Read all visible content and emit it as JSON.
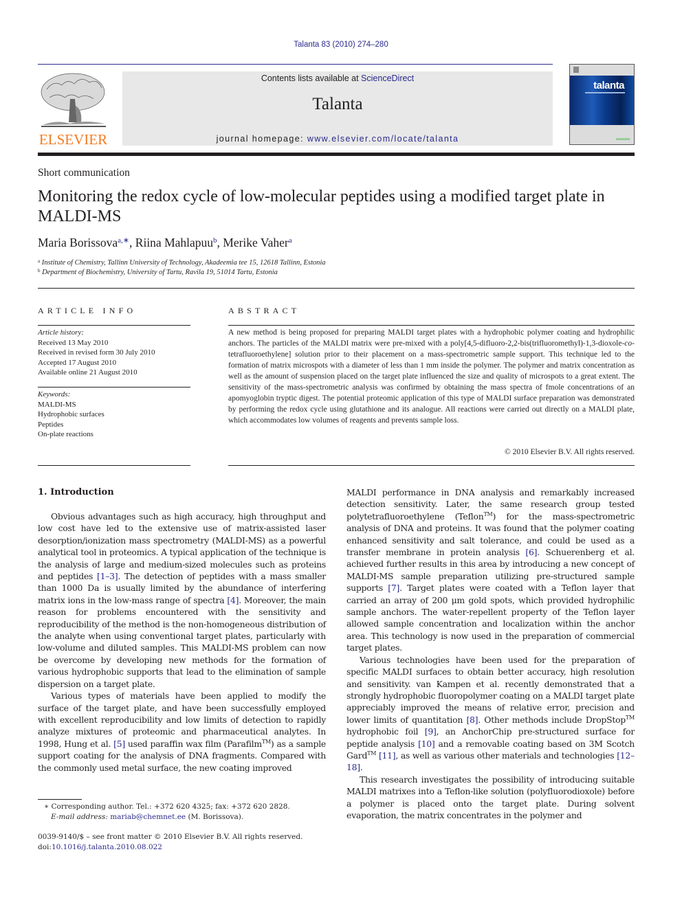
{
  "header": {
    "citation": "Talanta 83 (2010) 274–280",
    "contents_prefix": "Contents lists available at ",
    "contents_link": "ScienceDirect",
    "journal_name": "Talanta",
    "homepage_prefix": "journal homepage: ",
    "homepage_link": "www.elsevier.com/locate/talanta",
    "publisher_logo_text": "ELSEVIER",
    "cover_title": "talanta",
    "brand_color": "#f47b20",
    "link_color": "#2a2a8c"
  },
  "article": {
    "type": "Short communication",
    "title": "Monitoring the redox cycle of low-molecular peptides using a modified target plate in MALDI-MS",
    "authors": [
      {
        "name": "Maria Borissova",
        "sup": "a,∗",
        "sep": ", "
      },
      {
        "name": "Riina Mahlapuu",
        "sup": "b",
        "sep": ", "
      },
      {
        "name": "Merike Vaher",
        "sup": "a",
        "sep": ""
      }
    ],
    "affiliations": [
      {
        "key": "a",
        "text": "Institute of Chemistry, Tallinn University of Technology, Akadeemia tee 15, 12618 Tallinn, Estonia"
      },
      {
        "key": "b",
        "text": "Department of Biochemistry, University of Tartu, Ravila 19, 51014 Tartu, Estonia"
      }
    ]
  },
  "article_info": {
    "heading": "ARTICLE INFO",
    "history_label": "Article history:",
    "history": [
      "Received 13 May 2010",
      "Received in revised form 30 July 2010",
      "Accepted 17 August 2010",
      "Available online 21 August 2010"
    ],
    "keywords_label": "Keywords:",
    "keywords": [
      "MALDI-MS",
      "Hydrophobic surfaces",
      "Peptides",
      "On-plate reactions"
    ]
  },
  "abstract": {
    "heading": "ABSTRACT",
    "text_1": "A new method is being proposed for preparing MALDI target plates with a hydrophobic polymer coating and hydrophilic anchors. The particles of the MALDI matrix were pre-mixed with a poly[4,5-difluoro-2,2-bis(trifluoromethyl)-1,3-dioxole-",
    "text_italic": "co",
    "text_2": "-tetrafluoroethylene] solution prior to their placement on a mass-spectrometric sample support. This technique led to the formation of matrix microspots with a diameter of less than 1 mm inside the polymer. The polymer and matrix concentration as well as the amount of suspension placed on the target plate influenced the size and quality of microspots to a great extent. The sensitivity of the mass-spectrometric analysis was confirmed by obtaining the mass spectra of fmole concentrations of an apomyoglobin tryptic digest. The potential proteomic application of this type of MALDI surface preparation was demonstrated by performing the redox cycle using glutathione and its analogue. All reactions were carried out directly on a MALDI plate, which accommodates low volumes of reagents and prevents sample loss.",
    "copyright": "© 2010 Elsevier B.V. All rights reserved."
  },
  "introduction": {
    "heading": "1.  Introduction",
    "p1": {
      "a": "Obvious advantages such as high accuracy, high throughput and low cost have led to the extensive use of matrix-assisted laser desorption/ionization mass spectrometry (MALDI-MS) as a powerful analytical tool in proteomics. A typical application of the technique is the analysis of large and medium-sized molecules such as proteins and peptides ",
      "ref1": "[1–3]",
      "b": ". The detection of peptides with a mass smaller than 1000 Da is usually limited by the abundance of interfering matrix ions in the low-mass range of spectra ",
      "ref2": "[4]",
      "c": ". Moreover, the main reason for problems encountered with the sensitivity and reproducibility of the method is the non-homogeneous distribution of the analyte when using conventional target plates, particularly with low-volume and diluted samples. This MALDI-MS problem can now be overcome by developing new methods for the formation of various hydrophobic supports that lead to the elimination of sample dispersion on a target plate."
    },
    "p2": {
      "a": "Various types of materials have been applied to modify the surface of the target plate, and have been successfully employed with excellent reproducibility and low limits of detection to rapidly analyze mixtures of proteomic and pharmaceutical analytes. In 1998, Hung et al. ",
      "ref1": "[5]",
      "b": " used paraffin wax film (Parafilm",
      "tm": "TM",
      "c": ") as a sample support coating for the analysis of DNA fragments. Compared with the commonly used metal surface, the new coating improved"
    },
    "p3": {
      "a": "MALDI performance in DNA analysis and remarkably increased detection sensitivity. Later, the same research group tested polytetrafluoroethylene (Teflon",
      "tm": "TM",
      "b": ") for the mass-spectrometric analysis of DNA and proteins. It was found that the polymer coating enhanced sensitivity and salt tolerance, and could be used as a transfer membrane in protein analysis ",
      "ref1": "[6]",
      "c": ". Schuerenberg et al. achieved further results in this area by introducing a new concept of MALDI-MS sample preparation utilizing pre-structured sample supports ",
      "ref2": "[7]",
      "d": ". Target plates were coated with a Teflon layer that carried an array of 200 μm gold spots, which provided hydrophilic sample anchors. The water-repellent property of the Teflon layer allowed sample concentration and localization within the anchor area. This technology is now used in the preparation of commercial target plates."
    },
    "p4": {
      "a": "Various technologies have been used for the preparation of specific MALDI surfaces to obtain better accuracy, high resolution and sensitivity. van Kampen et al. recently demonstrated that a strongly hydrophobic fluoropolymer coating on a MALDI target plate appreciably improved the means of relative error, precision and lower limits of quantitation ",
      "ref1": "[8]",
      "b": ". Other methods include DropStop",
      "tm1": "TM",
      "c": " hydrophobic foil ",
      "ref2": "[9]",
      "d": ", an AnchorChip pre-structured surface for peptide analysis ",
      "ref3": "[10]",
      "e": " and a removable coating based on 3M Scotch Gard",
      "tm2": "TM",
      "f": " ",
      "ref4": "[11]",
      "g": ", as well as various other materials and technologies ",
      "ref5": "[12–18]",
      "h": "."
    },
    "p5": {
      "a": "This research investigates the possibility of introducing suitable MALDI matrixes into a Teflon-like solution (polyfluorodioxole) before a polymer is placed onto the target plate. During solvent evaporation, the matrix concentrates in the polymer and"
    }
  },
  "footnotes": {
    "corresponding": "∗ Corresponding author. Tel.: +372 620 4325; fax: +372 620 2828.",
    "email_label": "E-mail address: ",
    "email": "mariab@chemnet.ee",
    "email_suffix": " (M. Borissova).",
    "issn_line": "0039-9140/$ – see front matter © 2010 Elsevier B.V. All rights reserved.",
    "doi_label": "doi:",
    "doi": "10.1016/j.talanta.2010.08.022"
  }
}
